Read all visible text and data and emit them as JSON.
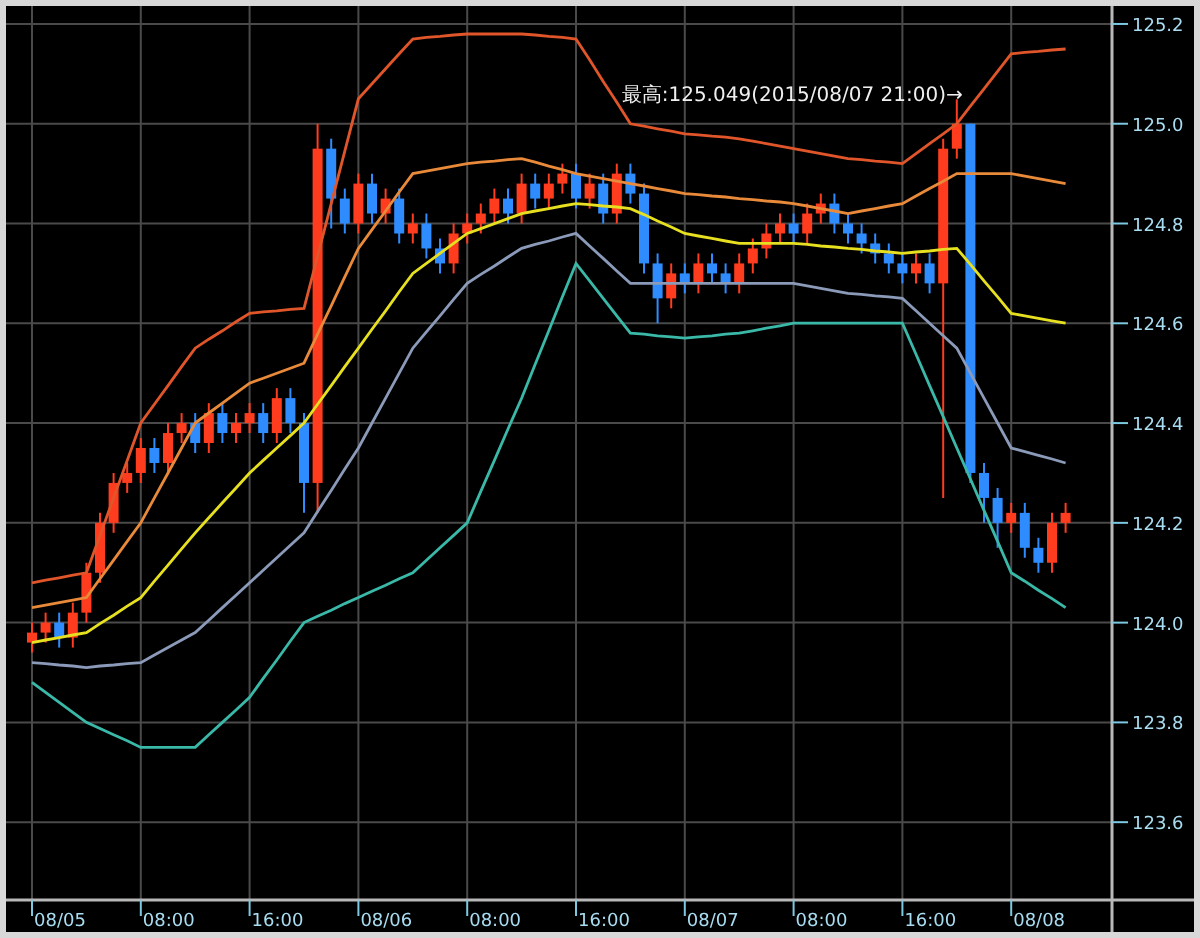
{
  "chart": {
    "time_axis_labels": [
      "08/05",
      "08:00",
      "16:00",
      "08/06",
      "08:00",
      "16:00",
      "08/07",
      "08:00",
      "16:00",
      "08/08"
    ],
    "chart_data": {
      "type": "candlestick",
      "grid": true,
      "categories": [
        null,
        null,
        null,
        null,
        null,
        null,
        null,
        null,
        null,
        null,
        null,
        null,
        null,
        null,
        null,
        null,
        null,
        null,
        null,
        null,
        null,
        null,
        null,
        null,
        null,
        null,
        null,
        null,
        null,
        null,
        null,
        null,
        null,
        null,
        null,
        null,
        null,
        null,
        null,
        null,
        null,
        null,
        null,
        null,
        null,
        null,
        null,
        null,
        null,
        null,
        null,
        null,
        null,
        null,
        null,
        null,
        null,
        null,
        null,
        null,
        null,
        null,
        null,
        null,
        null,
        null,
        null,
        null,
        null,
        null,
        null,
        null,
        null,
        null,
        null,
        null,
        null
      ],
      "ylim": [
        123.444,
        125.236
      ],
      "yticks": [
        {
          "value": 125.2,
          "label": "125.2"
        },
        {
          "value": 125.0,
          "label": "125.0"
        },
        {
          "value": 124.8,
          "label": "124.8"
        },
        {
          "value": 124.6,
          "label": "124.6"
        },
        {
          "value": 124.4,
          "label": "124.4"
        },
        {
          "value": 124.2,
          "label": "124.2"
        },
        {
          "value": 124.0,
          "label": "124.0"
        },
        {
          "value": 123.8,
          "label": "123.8"
        },
        {
          "value": 123.6,
          "label": "123.6"
        }
      ],
      "annotations": [
        {
          "text": "最高:125.049(2015/08/07 21:00)→"
        }
      ],
      "ohlc": [
        [
          123.96,
          124.0,
          123.94,
          123.98
        ],
        [
          123.98,
          124.02,
          123.96,
          124.0
        ],
        [
          124.0,
          124.02,
          123.95,
          123.97
        ],
        [
          123.97,
          124.04,
          123.95,
          124.02
        ],
        [
          124.02,
          124.12,
          124.0,
          124.1
        ],
        [
          124.1,
          124.22,
          124.08,
          124.2
        ],
        [
          124.2,
          124.3,
          124.18,
          124.28
        ],
        [
          124.28,
          124.32,
          124.26,
          124.3
        ],
        [
          124.3,
          124.37,
          124.28,
          124.35
        ],
        [
          124.35,
          124.37,
          124.3,
          124.32
        ],
        [
          124.32,
          124.4,
          124.3,
          124.38
        ],
        [
          124.38,
          124.42,
          124.36,
          124.4
        ],
        [
          124.4,
          124.42,
          124.34,
          124.36
        ],
        [
          124.36,
          124.44,
          124.34,
          124.42
        ],
        [
          124.42,
          124.44,
          124.36,
          124.38
        ],
        [
          124.38,
          124.42,
          124.36,
          124.4
        ],
        [
          124.4,
          124.44,
          124.38,
          124.42
        ],
        [
          124.42,
          124.44,
          124.36,
          124.38
        ],
        [
          124.38,
          124.47,
          124.36,
          124.45
        ],
        [
          124.45,
          124.47,
          124.38,
          124.4
        ],
        [
          124.4,
          124.42,
          124.22,
          124.28
        ],
        [
          124.28,
          125.0,
          124.22,
          124.95
        ],
        [
          124.95,
          124.97,
          124.79,
          124.85
        ],
        [
          124.85,
          124.87,
          124.78,
          124.8
        ],
        [
          124.8,
          124.9,
          124.78,
          124.88
        ],
        [
          124.88,
          124.9,
          124.8,
          124.82
        ],
        [
          124.82,
          124.87,
          124.8,
          124.85
        ],
        [
          124.85,
          124.87,
          124.76,
          124.78
        ],
        [
          124.78,
          124.82,
          124.76,
          124.8
        ],
        [
          124.8,
          124.82,
          124.73,
          124.75
        ],
        [
          124.75,
          124.77,
          124.7,
          124.72
        ],
        [
          124.72,
          124.8,
          124.7,
          124.78
        ],
        [
          124.78,
          124.82,
          124.76,
          124.8
        ],
        [
          124.8,
          124.84,
          124.78,
          124.82
        ],
        [
          124.82,
          124.87,
          124.8,
          124.85
        ],
        [
          124.85,
          124.87,
          124.8,
          124.82
        ],
        [
          124.82,
          124.9,
          124.8,
          124.88
        ],
        [
          124.88,
          124.9,
          124.83,
          124.85
        ],
        [
          124.85,
          124.9,
          124.83,
          124.88
        ],
        [
          124.88,
          124.92,
          124.86,
          124.9
        ],
        [
          124.9,
          124.92,
          124.83,
          124.85
        ],
        [
          124.85,
          124.9,
          124.83,
          124.88
        ],
        [
          124.88,
          124.9,
          124.8,
          124.82
        ],
        [
          124.82,
          124.92,
          124.8,
          124.9
        ],
        [
          124.9,
          124.92,
          124.84,
          124.86
        ],
        [
          124.86,
          124.88,
          124.7,
          124.72
        ],
        [
          124.72,
          124.74,
          124.6,
          124.65
        ],
        [
          124.65,
          124.72,
          124.63,
          124.7
        ],
        [
          124.7,
          124.72,
          124.66,
          124.68
        ],
        [
          124.68,
          124.74,
          124.66,
          124.72
        ],
        [
          124.72,
          124.74,
          124.68,
          124.7
        ],
        [
          124.7,
          124.72,
          124.66,
          124.68
        ],
        [
          124.68,
          124.74,
          124.66,
          124.72
        ],
        [
          124.72,
          124.77,
          124.7,
          124.75
        ],
        [
          124.75,
          124.8,
          124.73,
          124.78
        ],
        [
          124.78,
          124.82,
          124.76,
          124.8
        ],
        [
          124.8,
          124.82,
          124.76,
          124.78
        ],
        [
          124.78,
          124.84,
          124.76,
          124.82
        ],
        [
          124.82,
          124.86,
          124.8,
          124.84
        ],
        [
          124.84,
          124.86,
          124.78,
          124.8
        ],
        [
          124.8,
          124.82,
          124.76,
          124.78
        ],
        [
          124.78,
          124.8,
          124.74,
          124.76
        ],
        [
          124.76,
          124.78,
          124.72,
          124.74
        ],
        [
          124.74,
          124.76,
          124.7,
          124.72
        ],
        [
          124.72,
          124.74,
          124.68,
          124.7
        ],
        [
          124.7,
          124.74,
          124.68,
          124.72
        ],
        [
          124.72,
          124.74,
          124.66,
          124.68
        ],
        [
          124.68,
          124.97,
          124.25,
          124.95
        ],
        [
          124.95,
          125.049,
          124.93,
          125.0
        ],
        [
          125.0,
          125.0,
          124.28,
          124.3
        ],
        [
          124.3,
          124.32,
          124.2,
          124.25
        ],
        [
          124.25,
          124.27,
          124.15,
          124.2
        ],
        [
          124.2,
          124.24,
          124.18,
          124.22
        ],
        [
          124.22,
          124.24,
          124.13,
          124.15
        ],
        [
          124.15,
          124.17,
          124.1,
          124.12
        ],
        [
          124.12,
          124.22,
          124.1,
          124.2
        ],
        [
          124.2,
          124.24,
          124.18,
          124.22
        ]
      ],
      "series": [
        {
          "type": "line",
          "color": "#e0562a",
          "values": [
            124.08,
            124.085,
            124.09,
            124.095,
            124.1,
            124.175,
            124.25,
            124.325,
            124.4,
            124.438,
            124.475,
            124.513,
            124.55,
            124.568,
            124.585,
            124.603,
            124.62,
            124.623,
            124.625,
            124.628,
            124.63,
            124.735,
            124.84,
            124.945,
            125.05,
            125.08,
            125.11,
            125.14,
            125.17,
            125.173,
            125.175,
            125.178,
            125.18,
            125.18,
            125.18,
            125.18,
            125.18,
            125.178,
            125.175,
            125.173,
            125.17,
            125.128,
            125.085,
            125.043,
            125.0,
            124.995,
            124.99,
            124.985,
            124.98,
            124.978,
            124.975,
            124.973,
            124.97,
            124.965,
            124.96,
            124.955,
            124.95,
            124.945,
            124.94,
            124.935,
            124.93,
            124.928,
            124.925,
            124.923,
            124.92,
            124.94,
            124.96,
            124.98,
            125.0,
            125.035,
            125.07,
            125.105,
            125.14,
            125.143,
            125.145,
            125.148,
            125.15
          ]
        },
        {
          "type": "line",
          "color": "#e88a3a",
          "values": [
            124.03,
            124.035,
            124.04,
            124.045,
            124.05,
            124.088,
            124.125,
            124.163,
            124.2,
            124.25,
            124.3,
            124.35,
            124.4,
            124.42,
            124.44,
            124.46,
            124.48,
            124.49,
            124.5,
            124.51,
            124.52,
            124.578,
            124.635,
            124.693,
            124.75,
            124.788,
            124.825,
            124.863,
            124.9,
            124.905,
            124.91,
            124.915,
            124.92,
            124.923,
            124.925,
            124.928,
            124.93,
            124.923,
            124.915,
            124.908,
            124.9,
            124.895,
            124.89,
            124.885,
            124.88,
            124.875,
            124.87,
            124.865,
            124.86,
            124.858,
            124.855,
            124.853,
            124.85,
            124.848,
            124.845,
            124.843,
            124.84,
            124.835,
            124.83,
            124.825,
            124.82,
            124.825,
            124.83,
            124.835,
            124.84,
            124.855,
            124.87,
            124.885,
            124.9,
            124.9,
            124.9,
            124.9,
            124.9,
            124.895,
            124.89,
            124.885,
            124.88
          ]
        },
        {
          "type": "line",
          "color": "#e6e020",
          "values": [
            123.96,
            123.965,
            123.97,
            123.975,
            123.98,
            123.998,
            124.015,
            124.033,
            124.05,
            124.083,
            124.115,
            124.148,
            124.18,
            124.21,
            124.24,
            124.27,
            124.3,
            124.325,
            124.35,
            124.375,
            124.4,
            124.438,
            124.475,
            124.513,
            124.55,
            124.588,
            124.625,
            124.663,
            124.7,
            124.72,
            124.74,
            124.76,
            124.78,
            124.79,
            124.8,
            124.81,
            124.82,
            124.825,
            124.83,
            124.835,
            124.84,
            124.838,
            124.835,
            124.833,
            124.83,
            124.818,
            124.805,
            124.793,
            124.78,
            124.775,
            124.77,
            124.765,
            124.76,
            124.76,
            124.76,
            124.76,
            124.76,
            124.758,
            124.755,
            124.753,
            124.75,
            124.748,
            124.745,
            124.743,
            124.74,
            124.743,
            124.745,
            124.748,
            124.75,
            124.718,
            124.685,
            124.653,
            124.62,
            124.615,
            124.61,
            124.605,
            124.6
          ]
        },
        {
          "type": "line",
          "color": "#8a9ab8",
          "values": [
            123.92,
            123.918,
            123.915,
            123.913,
            123.91,
            123.913,
            123.915,
            123.918,
            123.92,
            123.935,
            123.95,
            123.965,
            123.98,
            124.005,
            124.03,
            124.055,
            124.08,
            124.105,
            124.13,
            124.155,
            124.18,
            124.223,
            124.265,
            124.308,
            124.35,
            124.4,
            124.45,
            124.5,
            124.55,
            124.583,
            124.615,
            124.648,
            124.68,
            124.698,
            124.715,
            124.733,
            124.75,
            124.758,
            124.765,
            124.773,
            124.78,
            124.755,
            124.73,
            124.705,
            124.68,
            124.68,
            124.68,
            124.68,
            124.68,
            124.68,
            124.68,
            124.68,
            124.68,
            124.68,
            124.68,
            124.68,
            124.68,
            124.675,
            124.67,
            124.665,
            124.66,
            124.658,
            124.655,
            124.653,
            124.65,
            124.625,
            124.6,
            124.575,
            124.55,
            124.5,
            124.45,
            124.4,
            124.35,
            124.343,
            124.335,
            124.328,
            124.32
          ]
        },
        {
          "type": "line",
          "color": "#3ab8a8",
          "values": [
            123.88,
            123.86,
            123.84,
            123.82,
            123.8,
            123.788,
            123.775,
            123.763,
            123.75,
            123.75,
            123.75,
            123.75,
            123.75,
            123.775,
            123.8,
            123.825,
            123.85,
            123.888,
            123.925,
            123.963,
            124.0,
            124.013,
            124.025,
            124.038,
            124.05,
            124.063,
            124.075,
            124.088,
            124.1,
            124.125,
            124.15,
            124.175,
            124.2,
            124.263,
            124.325,
            124.388,
            124.45,
            124.518,
            124.585,
            124.653,
            124.72,
            124.685,
            124.65,
            124.615,
            124.58,
            124.578,
            124.575,
            124.573,
            124.57,
            124.573,
            124.575,
            124.578,
            124.58,
            124.585,
            124.59,
            124.595,
            124.6,
            124.6,
            124.6,
            124.6,
            124.6,
            124.6,
            124.6,
            124.6,
            124.6,
            124.538,
            124.475,
            124.413,
            124.35,
            124.288,
            124.225,
            124.163,
            124.1,
            124.083,
            124.065,
            124.048,
            124.03
          ]
        }
      ],
      "stacked": false
    }
  }
}
